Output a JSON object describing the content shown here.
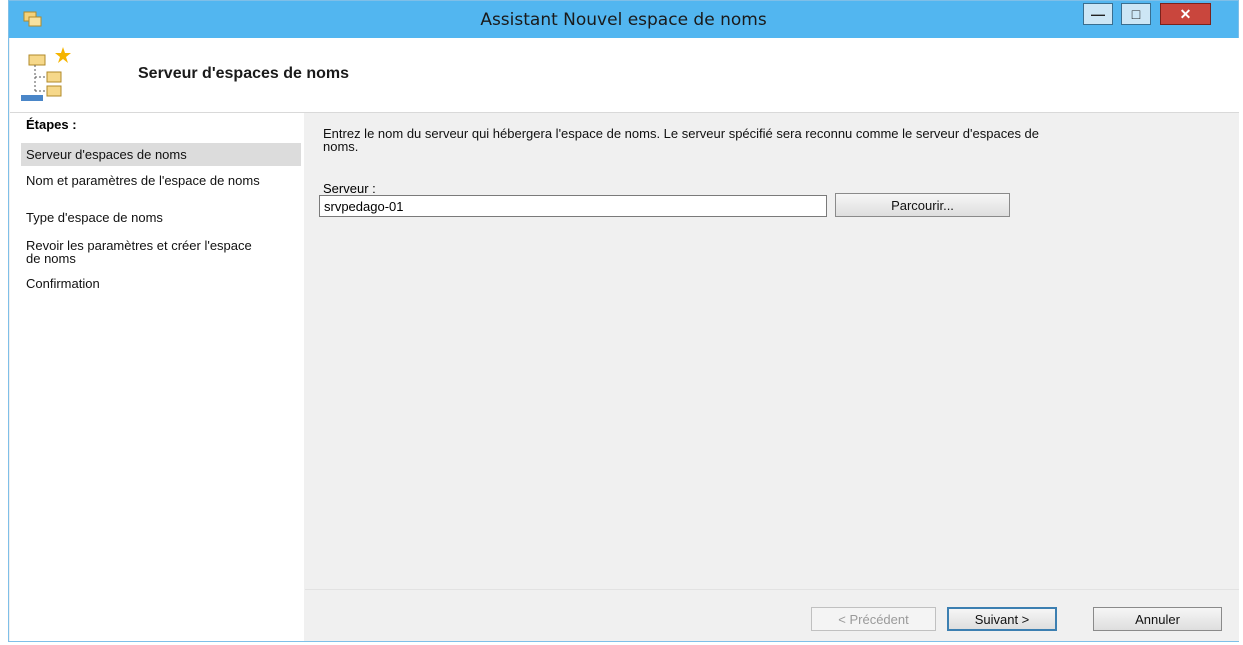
{
  "window": {
    "title": "Assistant Nouvel espace de noms"
  },
  "header": {
    "title": "Serveur d'espaces de noms"
  },
  "steps": {
    "heading": "Étapes :",
    "items": [
      {
        "label": "Serveur d'espaces de noms",
        "active": true
      },
      {
        "label": "Nom et paramètres de l'espace de noms",
        "active": false
      },
      {
        "label": "Type d'espace de noms",
        "active": false
      },
      {
        "label": "Revoir les paramètres et créer l'espace de noms",
        "active": false
      },
      {
        "label": "Confirmation",
        "active": false
      }
    ]
  },
  "content": {
    "description": "Entrez le nom du serveur qui hébergera l'espace de noms. Le serveur spécifié sera reconnu comme le serveur d'espaces de noms.",
    "server_label": "Serveur :",
    "server_value": "srvpedago-01",
    "browse_label": "Parcourir..."
  },
  "footer": {
    "prev_label": "< Précédent",
    "next_label": "Suivant >",
    "cancel_label": "Annuler"
  },
  "colors": {
    "titlebar": "#52b6f0",
    "close": "#c9463d",
    "default_button_border": "#3c7fb1"
  }
}
